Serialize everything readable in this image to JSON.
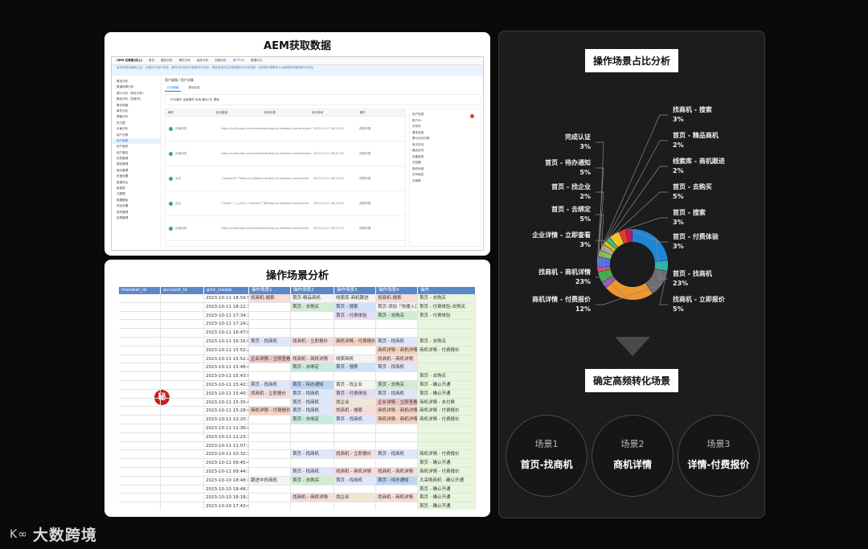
{
  "aem": {
    "title": "AEM获取数据",
    "topbar": [
      "UBM-云数据(线上)",
      "首页",
      "路径分析",
      "事件分析",
      "留存分析",
      "页面分析",
      "用户行为",
      "数据中心"
    ],
    "notice": "版本说明及最新公告：近期由于接口变更，事件分析的部分数据存在延迟，请在使用时注意数据统计时间范围，如有疑问请联系平台管理员获取帮助与支持。",
    "sidebar": [
      "概览分析",
      "渠道效果分析",
      "漏斗分析（转化分析）",
      "路径分析（页面流）",
      "事件明细",
      "事件分析",
      "屏幕分析",
      "热力图",
      "页面分析",
      "用户分群",
      "用户画像",
      "用户细查",
      "用户路径",
      "标签管理",
      "属性管理",
      "埋点管理",
      "页面设置",
      "数据导出",
      "维度表",
      "元数据",
      "数据看板",
      "项目设置",
      "成员管理",
      "权限管理"
    ],
    "breadcrumb": "用户画像 / 用户详情",
    "tabs": [
      "行为明细",
      "基础信息"
    ],
    "filter": "行为事件   全部事件   时间   最近7天   搜索",
    "table_headers": [
      "事件",
      "访问链接",
      "访问来源",
      "访问时间",
      "操作"
    ],
    "rows": [
      {
        "event": "页面浏览",
        "url": "https://s.alibaba.com/market/sourcing?s_supplier_entrance_detail",
        "src": "https://s.alibaba.com/selection",
        "time": "2023-10-11 08:21:00",
        "op": "查看详情"
      },
      {
        "event": "页面浏览",
        "url": "https://s.alibaba.com/market/sourcing?s_supplier_entrance_detail",
        "src": "https://s.alibaba.com/selection",
        "time": "2023-10-11 08:21:30",
        "op": "查看详情"
      },
      {
        "event": "点击",
        "url": "{\"pageUrl\":\"https://s.alibaba.com/market/detail\"}",
        "src": "https://s.alibaba.com/market",
        "time": "2023-10-11 08:22:05",
        "op": "查看详情"
      },
      {
        "event": "点击",
        "url": "{\"type\":\"_c_click\",\"content\":\"询价商机\"}",
        "src": "https://s.alibaba.com/market",
        "time": "2023-10-11 08:22:40",
        "op": "查看详情"
      },
      {
        "event": "页面浏览",
        "url": "https://s.alibaba.com/market/sourcing/form",
        "src": "https://s.alibaba.com/market",
        "time": "2023-10-11 08:23:10",
        "op": "查看详情"
      }
    ],
    "detail": [
      "用户信息",
      "账户ID",
      "手机号",
      "基本信息",
      "累计访问次数",
      "首次访问",
      "最近访问",
      "设备类型",
      "浏览器",
      "操作系统",
      "访问地区",
      "分辨率"
    ]
  },
  "scene_sheet": {
    "title": "操作场景分析",
    "headers": [
      "member_id",
      "account_id",
      "gmt_create",
      "操作场景1",
      "操作场景2",
      "操作场景3",
      "操作场景4",
      "操作"
    ],
    "seal": "秘",
    "rows": [
      [
        "2023-10-11 18:59:57",
        "找商机-搜索",
        "首页-精品商机",
        "线索库-商机跟进",
        "找商机-搜索",
        "首页 - 去购买"
      ],
      [
        "2023-10-11 18:22:36",
        "",
        "首页 - 去购买",
        "首页 - 搜索",
        "首页-添加「快捷入口」",
        "首页 - 付费体验-去购买"
      ],
      [
        "2023-10-11 17:34:15",
        "",
        "",
        "首页 - 付费体验",
        "首页 - 去购买",
        "首页 - 付费体验"
      ],
      [
        "2023-10-11 17:24:29",
        "",
        "",
        "",
        "",
        ""
      ],
      [
        "2023-10-11 16:47:04",
        "",
        "",
        "",
        "",
        ""
      ],
      [
        "2023-10-11 16:16:01",
        "首页 - 找商机",
        "找商机 - 立即报价",
        "商机详情 - 付费报价",
        "首页 - 找商机",
        "首页 - 去购买"
      ],
      [
        "2023-10-11 15:52:24",
        "",
        "",
        "",
        "商机详情 - 商机详情",
        "商机详情 - 付费报价"
      ],
      [
        "2023-10-11 15:52:24",
        "企业详情 - 立即查看",
        "找商机 - 商机详情",
        "线索商机",
        "找商机 - 商机详情",
        ""
      ],
      [
        "2023-10-11 15:48:46",
        "",
        "首页 - 去绑定",
        "首页 - 搜索",
        "首页 - 找商机",
        ""
      ],
      [
        "2023-10-11 15:43:54",
        "",
        "",
        "",
        "",
        "首页 - 去购买"
      ],
      [
        "2023-10-11 15:42:37",
        "首页 - 找商机",
        "首页 - 待办通知",
        "首页 - 找企业",
        "首页 - 去购买",
        "首页 - 确认开通"
      ],
      [
        "2023-10-11 15:40:16",
        "找商机 - 立即报价",
        "首页 - 找商机",
        "首页 - 付费体验",
        "首页 - 找商机",
        "首页 - 确认开通"
      ],
      [
        "2023-10-11 15:35:47",
        "",
        "首页 - 找商机",
        "找企业",
        "企业详情 - 立即查看",
        "商机详情 - 去付费"
      ],
      [
        "2023-10-11 15:28:48",
        "商机详情 - 付费报价",
        "首页 - 找商机",
        "找商机 - 搜索",
        "商机详情 - 商机详情",
        "商机详情 - 付费报价"
      ],
      [
        "2023-10-11 12:20:18",
        "",
        "首页 - 去绑定",
        "首页 - 找商机",
        "商机详情 - 商机详情",
        "商机详情 - 付费报价"
      ],
      [
        "2023-10-11 11:36:48",
        "",
        "",
        "",
        "",
        ""
      ],
      [
        "2023-10-11 11:23:18",
        "",
        "",
        "",
        "",
        ""
      ],
      [
        "2023-10-11 11:07:12",
        "",
        "",
        "",
        "",
        ""
      ],
      [
        "2023-10-11 10:32:36",
        "",
        "首页 - 找商机",
        "找商机 - 立即报价",
        "首页 - 找商机",
        "商机详情 - 付费报价"
      ],
      [
        "2023-10-11 09:45:46",
        "",
        "",
        "",
        "",
        "首页 - 确认开通"
      ],
      [
        "2023-10-11 09:44:14",
        "",
        "首页 - 找商机",
        "找商机 - 商机详情",
        "找商机 - 商机详情",
        "商机详情 - 付费报价"
      ],
      [
        "2023-10-10 18:48:33",
        "跟进中的商机",
        "首页 - 去购买",
        "首页 - 找商机",
        "首页 - 待办通知",
        "大采购商机 - 确认开通"
      ],
      [
        "2023-10-10 18:48:33",
        "",
        "",
        "",
        "",
        "首页 - 确认开通"
      ],
      [
        "2023-10-10 18:18:25",
        "",
        "找商机 - 商机详情",
        "找企业",
        "找商机 - 商机详情",
        "首页 - 确认开通"
      ],
      [
        "2023-10-10 17:43:44",
        "",
        "",
        "",
        "",
        "首页 - 确认开通"
      ]
    ]
  },
  "right": {
    "pie_title": "操作场景占比分析",
    "result_title": "确定高频转化场景",
    "scenes": [
      {
        "n": "场景1",
        "name": "首页-找商机"
      },
      {
        "n": "场景2",
        "name": "商机详情"
      },
      {
        "n": "场景3",
        "name": "详情-付费报价"
      }
    ]
  },
  "chart_data": {
    "type": "pie",
    "title": "操作场景占比分析",
    "donut": true,
    "slices": [
      {
        "label": "首页 - 找商机",
        "value": 23,
        "pct": "23%",
        "color": "#1f86d6"
      },
      {
        "label": "找商机 - 立即报价",
        "value": 5,
        "pct": "5%",
        "color": "#2fb3a6"
      },
      {
        "label": "商机详情 - 付费报价",
        "value": 12,
        "pct": "12%",
        "color": "#6e6e72"
      },
      {
        "label": "找商机 - 商机详情",
        "value": 23,
        "pct": "23%",
        "color": "#f0962d"
      },
      {
        "label": "企业详情 - 立即查看",
        "value": 3,
        "pct": "3%",
        "color": "#9b59b6"
      },
      {
        "label": "首页 - 去绑定",
        "value": 5,
        "pct": "5%",
        "color": "#3fae4a"
      },
      {
        "label": "首页 - 找企业",
        "value": 2,
        "pct": "2%",
        "color": "#e84a6f"
      },
      {
        "label": "首页 - 待办通知",
        "value": 5,
        "pct": "5%",
        "color": "#4c6ef5"
      },
      {
        "label": "完成认证",
        "value": 3,
        "pct": "3%",
        "color": "#8bc34a"
      },
      {
        "label": "找商机 - 搜索",
        "value": 3,
        "pct": "3%",
        "color": "#b2a98a"
      },
      {
        "label": "首页 - 精品商机",
        "value": 2,
        "pct": "2%",
        "color": "#d6c21f"
      },
      {
        "label": "线索库 - 商机跟进",
        "value": 2,
        "pct": "2%",
        "color": "#3cbf86"
      },
      {
        "label": "首页 - 去购买",
        "value": 5,
        "pct": "5%",
        "color": "#f2c12e"
      },
      {
        "label": "首页 - 搜索",
        "value": 3,
        "pct": "3%",
        "color": "#e83b2a"
      },
      {
        "label": "首页 - 付费体验",
        "value": 3,
        "pct": "3%",
        "color": "#c2185b"
      }
    ]
  },
  "watermark": "大数跨境"
}
